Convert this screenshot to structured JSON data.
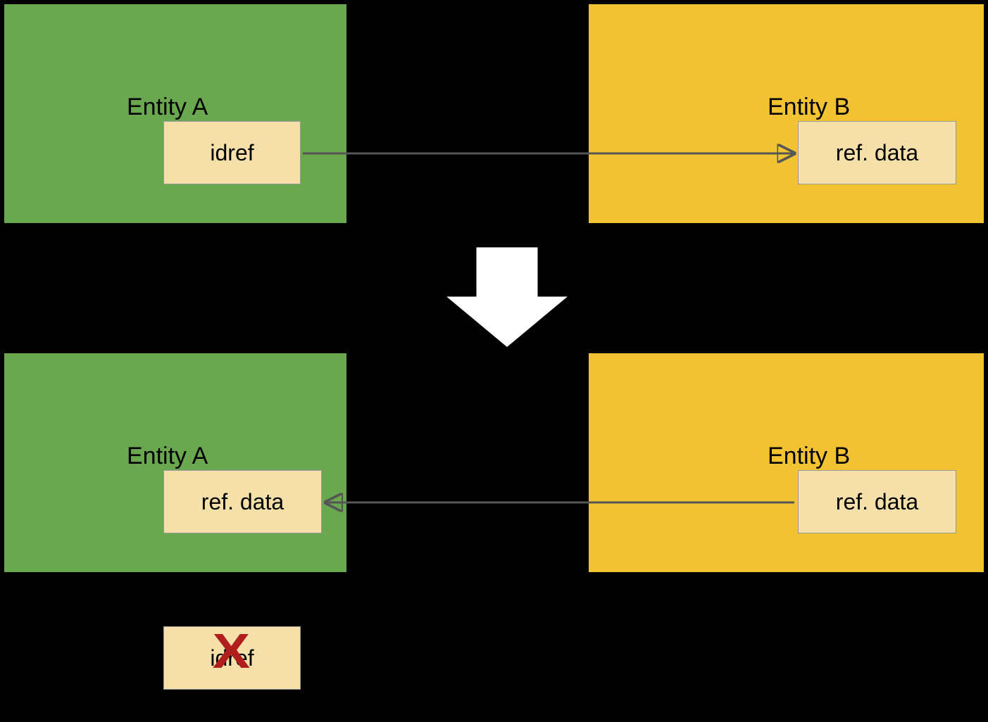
{
  "top": {
    "entityA": {
      "title": "Entity A",
      "tag": "idref"
    },
    "entityB": {
      "title": "Entity B",
      "tag": "ref. data"
    }
  },
  "bottom": {
    "entityA": {
      "title": "Entity A",
      "tag": "ref. data"
    },
    "entityB": {
      "title": "Entity B",
      "tag": "ref. data"
    }
  },
  "removed": {
    "tag": "idref"
  }
}
